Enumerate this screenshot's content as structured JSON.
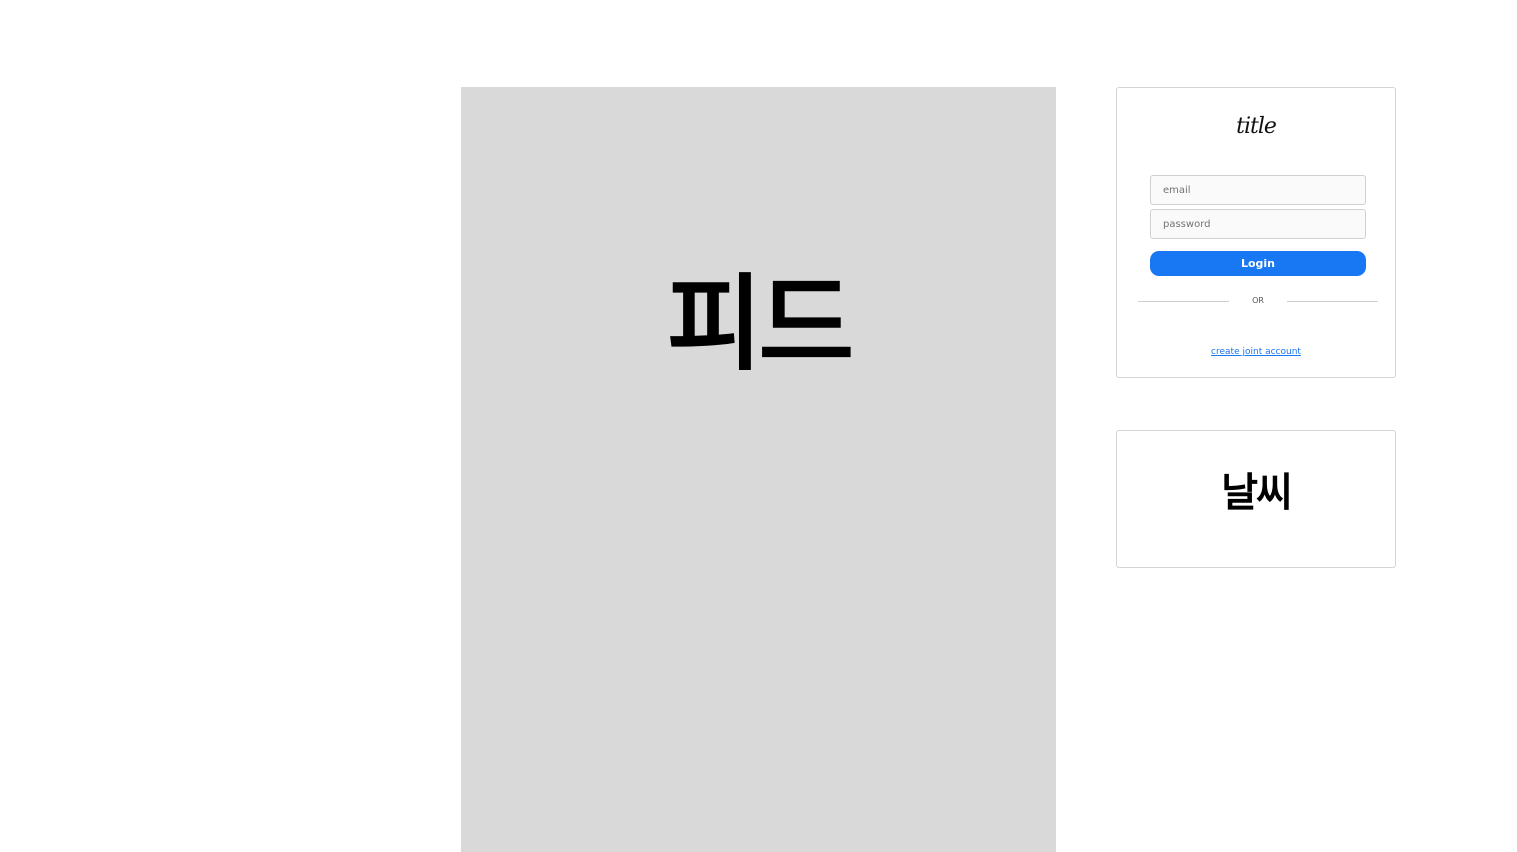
{
  "feed": {
    "title": "피드"
  },
  "login": {
    "logo": "title",
    "email_placeholder": "email",
    "password_placeholder": "password",
    "login_label": "Login",
    "divider_text": "OR",
    "signup_link": "create joint account"
  },
  "weather": {
    "title": "날씨"
  },
  "colors": {
    "feed_background": "#d9d9d9",
    "primary_button": "#1877f2",
    "link": "#1877f2",
    "card_border": "#d4d4d4"
  }
}
